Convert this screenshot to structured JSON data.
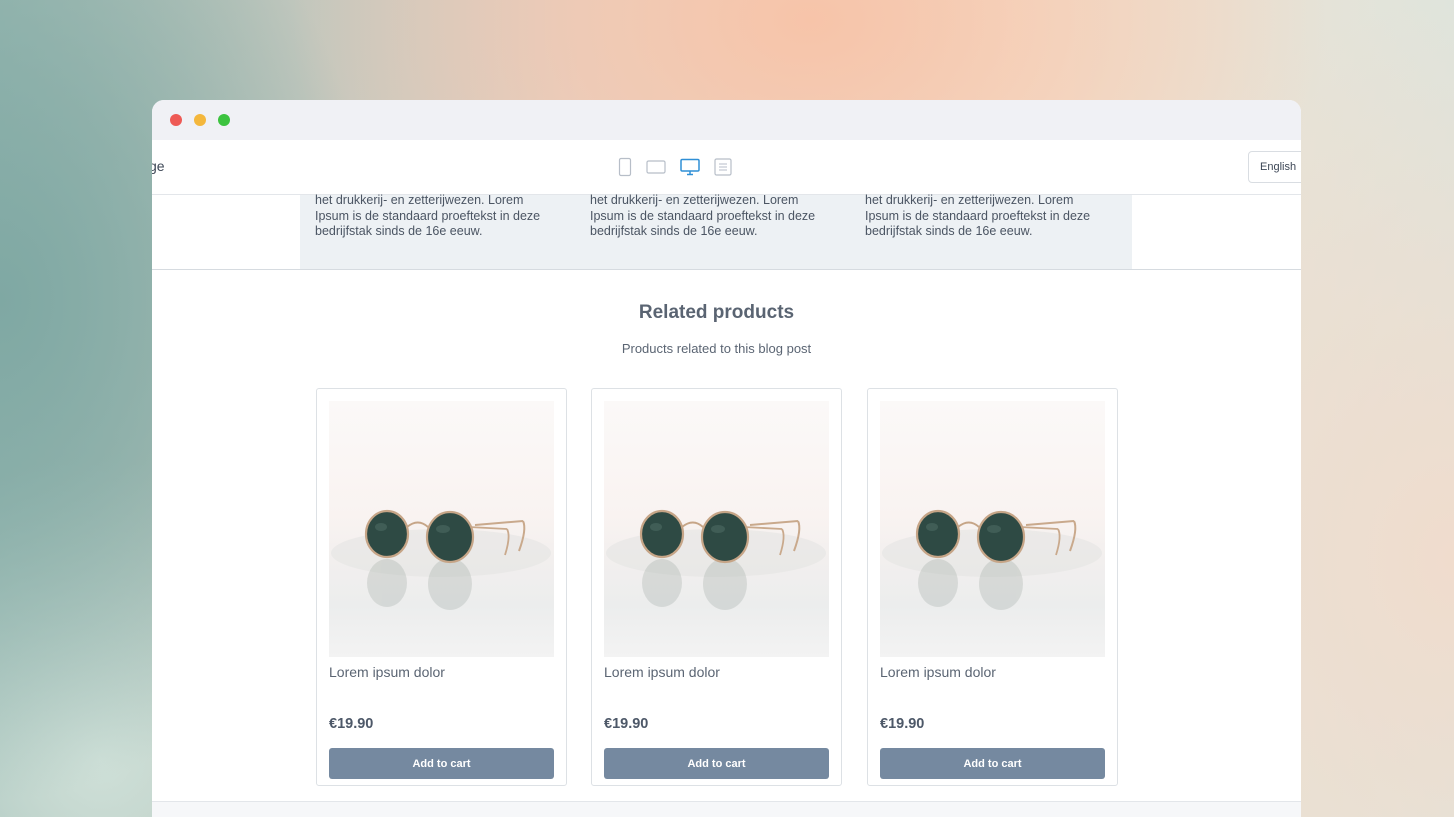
{
  "toolbar": {
    "left_text": "ge",
    "device_icons": [
      "phone-icon",
      "tablet-icon",
      "desktop-icon",
      "document-icon"
    ],
    "active_device": "desktop-icon",
    "language": "English",
    "accent_color": "#2f8fd6"
  },
  "blog_strip": {
    "columns": [
      "het drukkerij- en zetterijwezen. Lorem Ipsum is de standaard proeftekst in deze bedrijfstak sinds de 16e eeuw.",
      "het drukkerij- en zetterijwezen. Lorem Ipsum is de standaard proeftekst in deze bedrijfstak sinds de 16e eeuw.",
      "het drukkerij- en zetterijwezen. Lorem Ipsum is de standaard proeftekst in deze bedrijfstak sinds de 16e eeuw."
    ]
  },
  "related": {
    "title": "Related products",
    "subtitle": "Products related to this blog post",
    "products": [
      {
        "name": "Lorem ipsum dolor",
        "price": "€19.90",
        "button": "Add to cart",
        "image": "sunglasses-photo"
      },
      {
        "name": "Lorem ipsum dolor",
        "price": "€19.90",
        "button": "Add to cart",
        "image": "sunglasses-photo"
      },
      {
        "name": "Lorem ipsum dolor",
        "price": "€19.90",
        "button": "Add to cart",
        "image": "sunglasses-photo"
      }
    ]
  },
  "colors": {
    "button_bg": "#7589a0",
    "strip_bg": "#edf1f4"
  }
}
